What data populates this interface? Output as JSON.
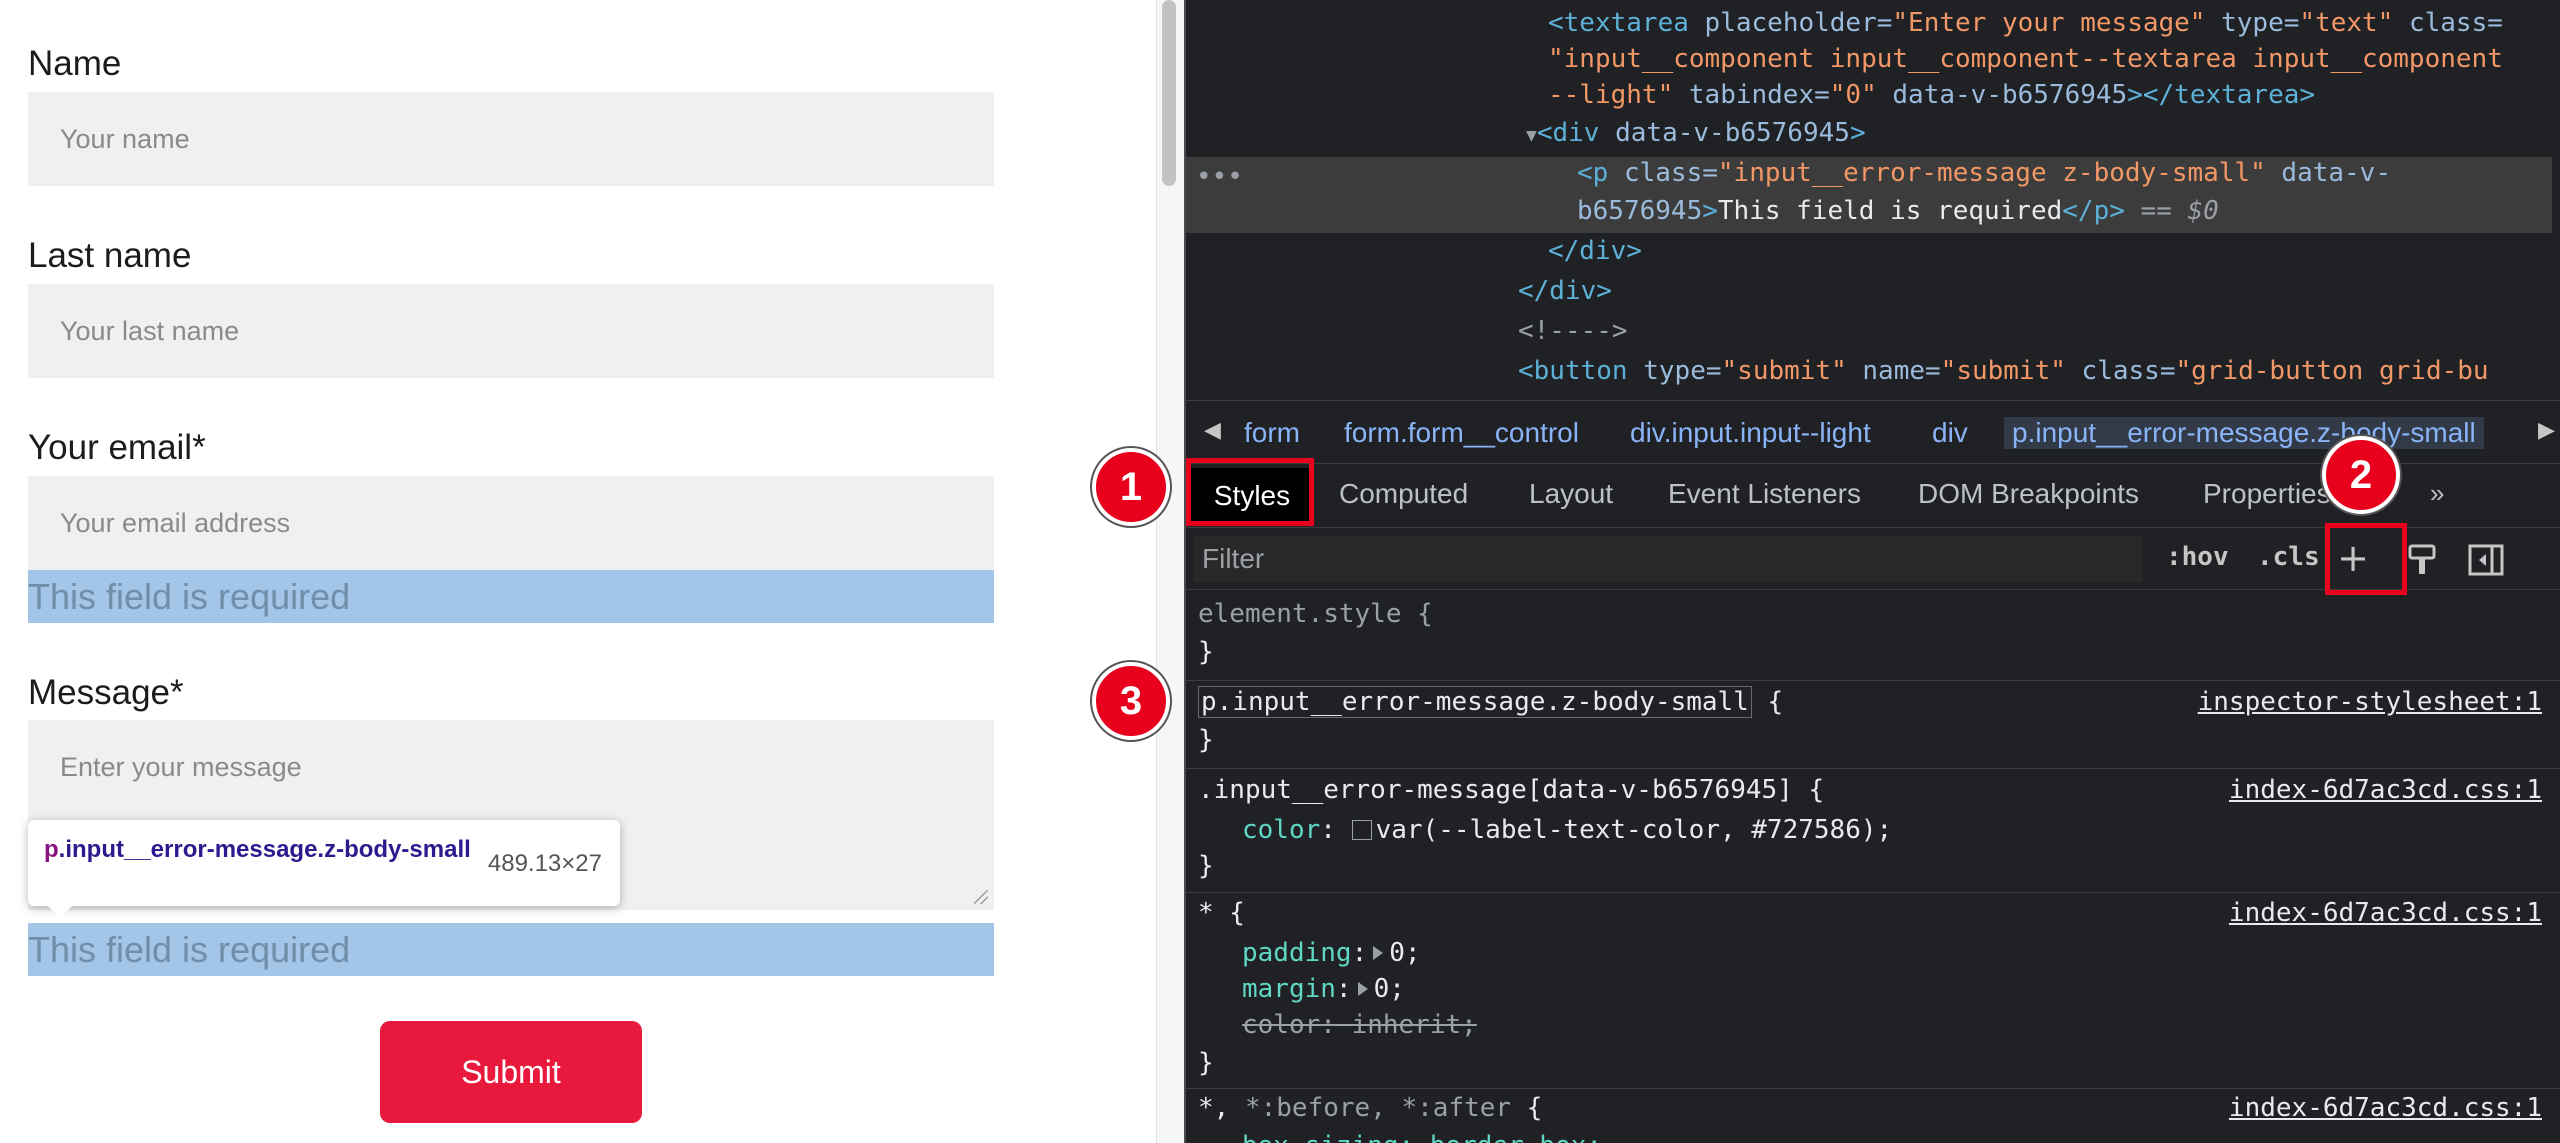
{
  "form": {
    "name_label": "Name",
    "name_placeholder": "Your name",
    "lastname_label": "Last name",
    "lastname_placeholder": "Your last name",
    "email_label": "Your email*",
    "email_placeholder": "Your email address",
    "email_error": "This field is required",
    "message_label": "Message*",
    "message_placeholder": "Enter your message",
    "message_error": "This field is required",
    "submit_label": "Submit"
  },
  "tooltip": {
    "tag": "p",
    "classes": ".input__error-message.z-body-small",
    "size": "489.13×27"
  },
  "elements_tree": {
    "line1": {
      "tag_open": "<textarea ",
      "a1": "placeholder=",
      "v1": "\"Enter your message\"",
      "a2": " type=",
      "v2": "\"text\"",
      "a3": " class="
    },
    "line2": {
      "v": "\"input__component input__component--textarea input__component"
    },
    "line3": {
      "v": "--light\"",
      "a": " tabindex=",
      "v2": "\"0\"",
      "a2": " data-v-b6576945",
      "close": "></textarea>"
    },
    "line4": {
      "tag": "<div ",
      "a": "data-v-b6576945",
      "close": ">"
    },
    "line5": {
      "tag": "<p ",
      "a": "class=",
      "v": "\"input__error-message z-body-small\"",
      "a2": " data-v-"
    },
    "line6": {
      "a": "b6576945",
      "close": ">",
      "text": "This field is required",
      "endtag": "</p>",
      "eq": " == ",
      "dollar": "$0"
    },
    "line7": "</div>",
    "line8": "</div>",
    "line9": "<!---->",
    "line10": {
      "tag": "<button ",
      "a1": "type=",
      "v1": "\"submit\"",
      "a2": " name=",
      "v2": "\"submit\"",
      "a3": " class=",
      "v3": "\"grid-button grid-bu"
    },
    "ellipsis": "•••"
  },
  "breadcrumbs": [
    "form",
    "form.form__control",
    "div.input.input--light",
    "div",
    "p.input__error-message.z-body-small"
  ],
  "tabs": [
    "Styles",
    "Computed",
    "Layout",
    "Event Listeners",
    "DOM Breakpoints",
    "Properties"
  ],
  "filter": {
    "placeholder": "Filter",
    "hov": ":hov",
    "cls": ".cls",
    "plus": "+"
  },
  "styles": {
    "element_style": "element.style {",
    "close": "}",
    "rule1_selector": "p.input__error-message.z-body-small",
    "rule1_brace": " {",
    "rule1_source": "inspector-stylesheet:1",
    "rule2_selector": ".input__error-message[data-v-b6576945] {",
    "rule2_source": "index-6d7ac3cd.css:1",
    "rule2_prop": "color",
    "rule2_value": "var(--label-text-color, #727586);",
    "rule3_selector": "* {",
    "rule3_source": "index-6d7ac3cd.css:1",
    "rule3_p1": "padding",
    "rule3_v1": "0;",
    "rule3_p2": "margin",
    "rule3_v2": "0;",
    "rule3_p3": "color: inherit;",
    "rule4_selector_a": "*, ",
    "rule4_selector_b": "*:before, *:after",
    "rule4_brace": " {",
    "rule4_source": "index-6d7ac3cd.css:1",
    "rule4_partial": "box-sizing: border-box;"
  },
  "annotations": [
    "1",
    "2",
    "3"
  ],
  "colors": {
    "submit": "#e8193c",
    "error_highlight": "#a2c5e8",
    "annotation_red": "#e8001c",
    "devtools_bg": "#202124"
  }
}
